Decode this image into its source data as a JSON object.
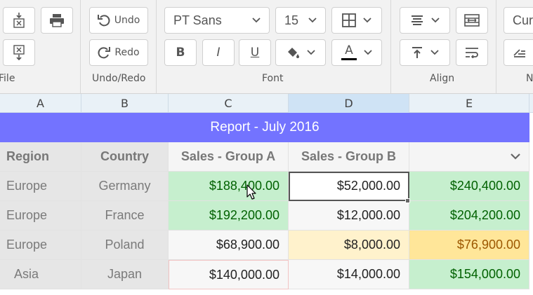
{
  "ribbon": {
    "file_label": "File",
    "undo_label": "Undo",
    "redo_label": "Redo",
    "undoredo_group_label": "Undo/Redo",
    "font_name": "PT Sans",
    "font_size": "15",
    "font_group_label": "Font",
    "bold_label": "B",
    "italic_label": "I",
    "underline_label": "U",
    "font_color_label": "A",
    "align_group_label": "Align",
    "number_format": "Cur",
    "number_group_label": "N"
  },
  "colors": {
    "title_bg": "#7373ff",
    "good_fill": "#c6efce",
    "neutral_fill": "#ffe699",
    "selection_header": "#cfe3f5"
  },
  "columns": [
    "A",
    "B",
    "C",
    "D",
    "E"
  ],
  "sheet": {
    "title": "Report - July 2016",
    "headers": [
      "Region",
      "Country",
      "Sales - Group A",
      "Sales - Group B",
      ""
    ],
    "rows": [
      [
        "Europe",
        "Germany",
        "$188,400.00",
        "$52,000.00",
        "$240,400.00"
      ],
      [
        "Europe",
        "France",
        "$192,200.00",
        "$12,000.00",
        "$204,200.00"
      ],
      [
        "Europe",
        "Poland",
        "$68,900.00",
        "$8,000.00",
        "$76,900.00"
      ],
      [
        "Asia",
        "Japan",
        "$140,000.00",
        "$14,000.00",
        "$154,000.00"
      ]
    ]
  }
}
